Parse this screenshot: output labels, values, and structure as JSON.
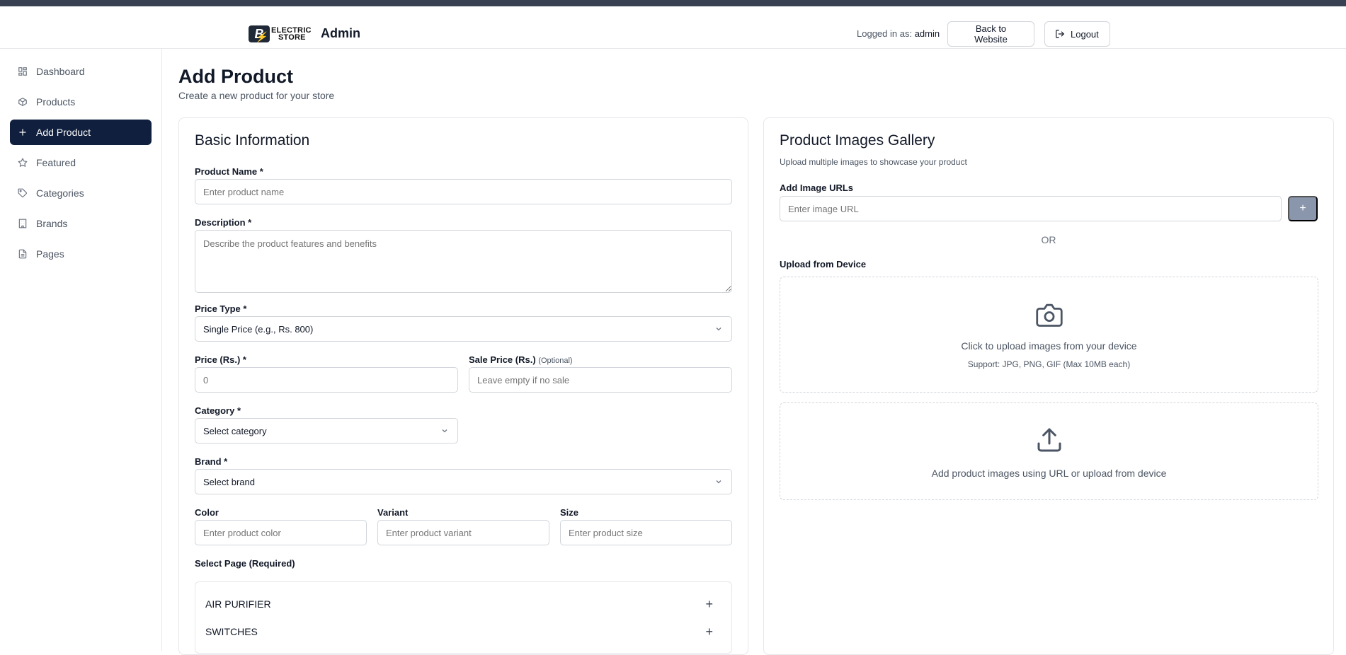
{
  "header": {
    "logo_top": "ELECTRIC",
    "logo_bottom": "STORE",
    "admin_title": "Admin",
    "logged_in_prefix": "Logged in as:",
    "logged_in_user": "admin",
    "back_label": "Back to Website",
    "logout_label": "Logout"
  },
  "sidebar": {
    "items": [
      {
        "label": "Dashboard",
        "icon": "dashboard-icon"
      },
      {
        "label": "Products",
        "icon": "package-icon"
      },
      {
        "label": "Add Product",
        "icon": "plus-icon",
        "active": true
      },
      {
        "label": "Featured",
        "icon": "star-icon"
      },
      {
        "label": "Categories",
        "icon": "tag-icon"
      },
      {
        "label": "Brands",
        "icon": "building-icon"
      },
      {
        "label": "Pages",
        "icon": "file-icon"
      }
    ]
  },
  "page": {
    "title": "Add Product",
    "subtitle": "Create a new product for your store"
  },
  "basic": {
    "title": "Basic Information",
    "product_name_label": "Product Name *",
    "product_name_placeholder": "Enter product name",
    "description_label": "Description *",
    "description_placeholder": "Describe the product features and benefits",
    "price_type_label": "Price Type *",
    "price_type_value": "Single Price (e.g., Rs. 800)",
    "price_label": "Price (Rs.) *",
    "price_placeholder": "0",
    "sale_price_label": "Sale Price (Rs.)",
    "sale_price_optional": "(Optional)",
    "sale_price_placeholder": "Leave empty if no sale",
    "category_label": "Category *",
    "category_value": "Select category",
    "brand_label": "Brand *",
    "brand_value": "Select brand",
    "color_label": "Color",
    "color_placeholder": "Enter product color",
    "variant_label": "Variant",
    "variant_placeholder": "Enter product variant",
    "size_label": "Size",
    "size_placeholder": "Enter product size",
    "select_page_label": "Select Page (Required)",
    "pages": [
      "AIR PURIFIER",
      "SWITCHES"
    ]
  },
  "gallery": {
    "title": "Product Images Gallery",
    "subtitle": "Upload multiple images to showcase your product",
    "add_urls_label": "Add Image URLs",
    "url_placeholder": "Enter image URL",
    "add_button": "+",
    "or_text": "OR",
    "upload_label": "Upload from Device",
    "upload_main": "Click to upload images from your device",
    "upload_support": "Support: JPG, PNG, GIF (Max 10MB each)",
    "empty_text": "Add product images using URL or upload from device"
  }
}
